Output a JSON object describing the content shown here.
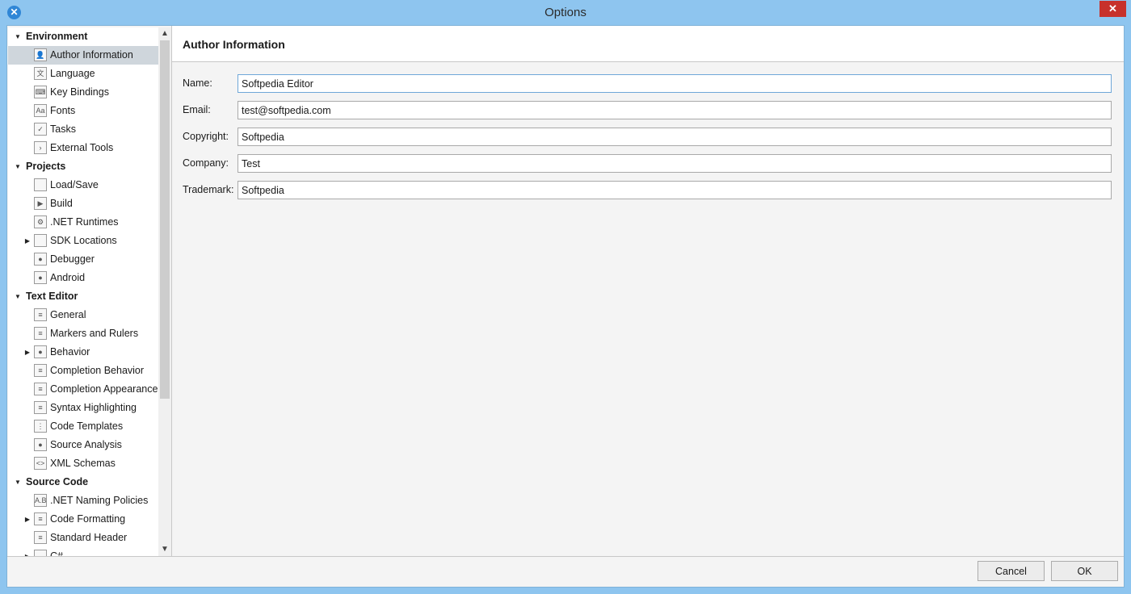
{
  "window": {
    "title": "Options",
    "app_icon_glyph": "✕",
    "close_glyph": "✕"
  },
  "sidebar": {
    "nodes": [
      {
        "kind": "section",
        "label": "Environment",
        "expanded": true
      },
      {
        "kind": "item",
        "label": "Author Information",
        "icon": "author-icon",
        "glyph": "👤",
        "selected": true
      },
      {
        "kind": "item",
        "label": "Language",
        "icon": "language-icon",
        "glyph": "文"
      },
      {
        "kind": "item",
        "label": "Key Bindings",
        "icon": "key-bindings-icon",
        "glyph": "⌨"
      },
      {
        "kind": "item",
        "label": "Fonts",
        "icon": "fonts-icon",
        "glyph": "Aa"
      },
      {
        "kind": "item",
        "label": "Tasks",
        "icon": "tasks-icon",
        "glyph": "✓"
      },
      {
        "kind": "item",
        "label": "External Tools",
        "icon": "terminal-icon",
        "glyph": "›"
      },
      {
        "kind": "section",
        "label": "Projects",
        "expanded": true
      },
      {
        "kind": "item",
        "label": "Load/Save",
        "icon": "load-save-icon",
        "glyph": ""
      },
      {
        "kind": "item",
        "label": "Build",
        "icon": "build-icon",
        "glyph": "▶"
      },
      {
        "kind": "item",
        "label": ".NET Runtimes",
        "icon": "gear-icon",
        "glyph": "⚙"
      },
      {
        "kind": "item",
        "label": "SDK Locations",
        "icon": "folder-icon",
        "glyph": "",
        "collapsed_arrow": true
      },
      {
        "kind": "item",
        "label": "Debugger",
        "icon": "debugger-bug-icon",
        "glyph": "●"
      },
      {
        "kind": "item",
        "label": "Android",
        "icon": "android-icon",
        "glyph": "●"
      },
      {
        "kind": "section",
        "label": "Text Editor",
        "expanded": true
      },
      {
        "kind": "item",
        "label": "General",
        "icon": "editor-general-icon",
        "glyph": "≡"
      },
      {
        "kind": "item",
        "label": "Markers and Rulers",
        "icon": "markers-icon",
        "glyph": "≡"
      },
      {
        "kind": "item",
        "label": "Behavior",
        "icon": "behavior-brain-icon",
        "glyph": "●",
        "collapsed_arrow": true
      },
      {
        "kind": "item",
        "label": "Completion Behavior",
        "icon": "completion-behavior-icon",
        "glyph": "≡"
      },
      {
        "kind": "item",
        "label": "Completion Appearance",
        "icon": "completion-appearance-icon",
        "glyph": "≡"
      },
      {
        "kind": "item",
        "label": "Syntax Highlighting",
        "icon": "syntax-highlighting-icon",
        "glyph": "≡"
      },
      {
        "kind": "item",
        "label": "Code Templates",
        "icon": "code-templates-icon",
        "glyph": "⋮"
      },
      {
        "kind": "item",
        "label": "Source Analysis",
        "icon": "source-analysis-dot-icon",
        "glyph": "●"
      },
      {
        "kind": "item",
        "label": "XML Schemas",
        "icon": "xml-icon",
        "glyph": "<>"
      },
      {
        "kind": "section",
        "label": "Source Code",
        "expanded": true
      },
      {
        "kind": "item",
        "label": ".NET Naming Policies",
        "icon": "naming-policies-icon",
        "glyph": "A.B"
      },
      {
        "kind": "item",
        "label": "Code Formatting",
        "icon": "code-formatting-icon",
        "glyph": "≡",
        "collapsed_arrow": true
      },
      {
        "kind": "item",
        "label": "Standard Header",
        "icon": "standard-header-icon",
        "glyph": "≡"
      },
      {
        "kind": "item",
        "label": "C#",
        "icon": "csharp-icon",
        "glyph": "",
        "collapsed_arrow": true
      }
    ]
  },
  "content": {
    "title": "Author Information",
    "fields": [
      {
        "label": "Name:",
        "value": "Softpedia Editor",
        "focused": true
      },
      {
        "label": "Email:",
        "value": "test@softpedia.com"
      },
      {
        "label": "Copyright:",
        "value": "Softpedia"
      },
      {
        "label": "Company:",
        "value": "Test"
      },
      {
        "label": "Trademark:",
        "value": "Softpedia"
      }
    ]
  },
  "buttons": {
    "cancel": "Cancel",
    "ok": "OK"
  },
  "colors": {
    "titlebar": "#8ec5ef",
    "selection": "#cfd6dc",
    "close": "#c7312b"
  },
  "scroll": {
    "up_glyph": "▲",
    "down_glyph": "▼"
  }
}
